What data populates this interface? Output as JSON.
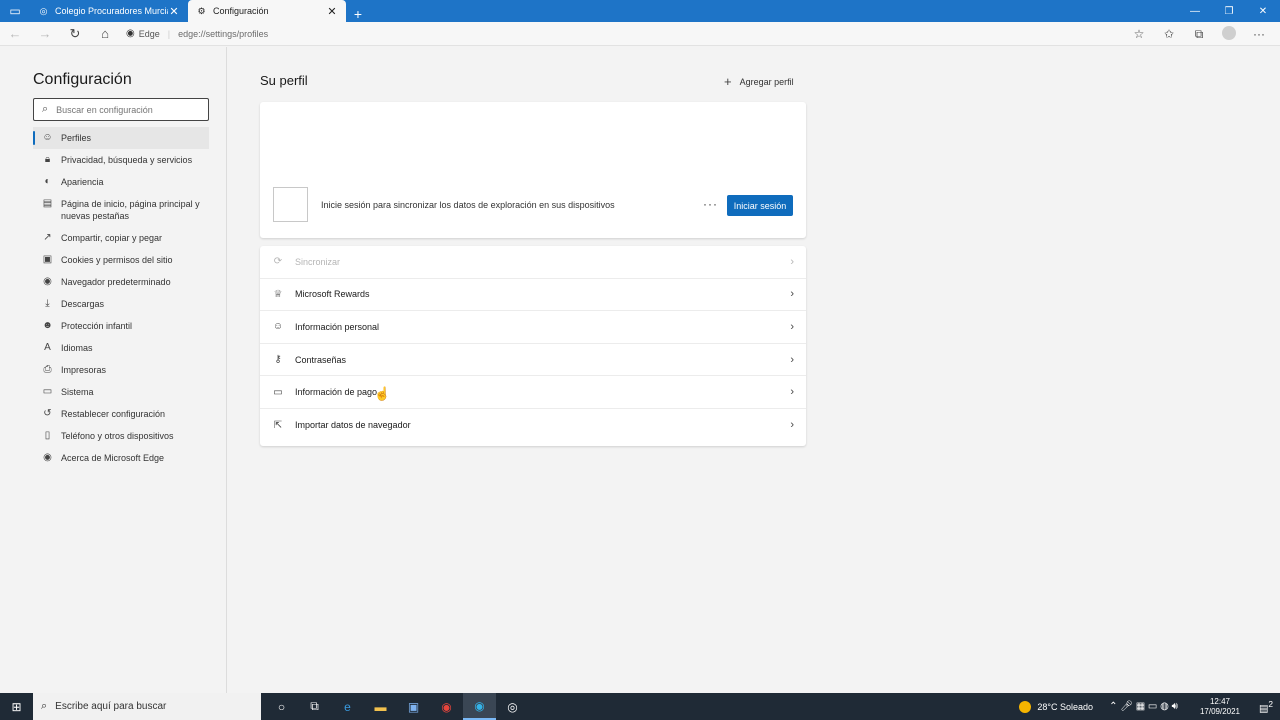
{
  "browser": {
    "tabs": [
      {
        "title": "Colegio Procuradores Murcia",
        "active": false
      },
      {
        "title": "Configuración",
        "active": true
      }
    ],
    "address": {
      "site_label": "Edge",
      "url": "edge://settings/profiles"
    }
  },
  "sidebar": {
    "title": "Configuración",
    "search_placeholder": "Buscar en configuración",
    "items": [
      {
        "label": "Perfiles",
        "icon": "profile-icon",
        "active": true
      },
      {
        "label": "Privacidad, búsqueda y servicios",
        "icon": "lock-icon"
      },
      {
        "label": "Apariencia",
        "icon": "appearance-icon"
      },
      {
        "label": "Página de inicio, página principal y nuevas pestañas",
        "icon": "home-page-icon"
      },
      {
        "label": "Compartir, copiar y pegar",
        "icon": "share-icon"
      },
      {
        "label": "Cookies y permisos del sitio",
        "icon": "cookie-icon"
      },
      {
        "label": "Navegador predeterminado",
        "icon": "browser-icon"
      },
      {
        "label": "Descargas",
        "icon": "download-icon"
      },
      {
        "label": "Protección infantil",
        "icon": "family-icon"
      },
      {
        "label": "Idiomas",
        "icon": "language-icon"
      },
      {
        "label": "Impresoras",
        "icon": "printer-icon"
      },
      {
        "label": "Sistema",
        "icon": "system-icon"
      },
      {
        "label": "Restablecer configuración",
        "icon": "reset-icon"
      },
      {
        "label": "Teléfono y otros dispositivos",
        "icon": "phone-icon"
      },
      {
        "label": "Acerca de Microsoft Edge",
        "icon": "edge-icon"
      }
    ]
  },
  "main": {
    "title": "Su perfil",
    "add_profile": "Agregar perfil",
    "card": {
      "message": "Inicie sesión para sincronizar los datos de exploración en sus dispositivos",
      "more": "···",
      "signin_button": "Iniciar sesión"
    },
    "rows": [
      {
        "label": "Sincronizar",
        "icon": "sync-icon",
        "disabled": true
      },
      {
        "label": "Microsoft Rewards",
        "icon": "trophy-icon"
      },
      {
        "label": "Información personal",
        "icon": "person-icon"
      },
      {
        "label": "Contraseñas",
        "icon": "key-icon"
      },
      {
        "label": "Información de pago",
        "icon": "card-icon"
      },
      {
        "label": "Importar datos de navegador",
        "icon": "import-icon"
      }
    ]
  },
  "taskbar": {
    "search_placeholder": "Escribe aquí para buscar",
    "weather": "28°C  Soleado",
    "time": "12:47",
    "date": "17/09/2021",
    "notifications": "2"
  }
}
